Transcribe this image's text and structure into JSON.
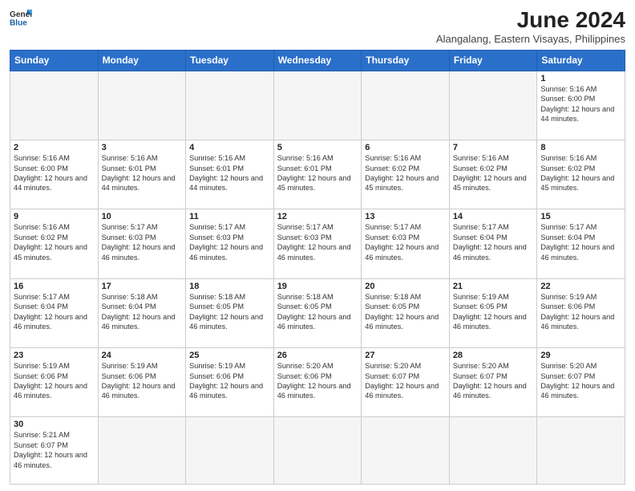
{
  "header": {
    "logo_general": "General",
    "logo_blue": "Blue",
    "month_year": "June 2024",
    "location": "Alangalang, Eastern Visayas, Philippines"
  },
  "days_of_week": [
    "Sunday",
    "Monday",
    "Tuesday",
    "Wednesday",
    "Thursday",
    "Friday",
    "Saturday"
  ],
  "weeks": [
    [
      {
        "day": null,
        "info": null
      },
      {
        "day": null,
        "info": null
      },
      {
        "day": null,
        "info": null
      },
      {
        "day": null,
        "info": null
      },
      {
        "day": null,
        "info": null
      },
      {
        "day": null,
        "info": null
      },
      {
        "day": "1",
        "info": "Sunrise: 5:16 AM\nSunset: 6:00 PM\nDaylight: 12 hours\nand 44 minutes."
      }
    ],
    [
      {
        "day": "2",
        "info": "Sunrise: 5:16 AM\nSunset: 6:00 PM\nDaylight: 12 hours\nand 44 minutes."
      },
      {
        "day": "3",
        "info": "Sunrise: 5:16 AM\nSunset: 6:01 PM\nDaylight: 12 hours\nand 44 minutes."
      },
      {
        "day": "4",
        "info": "Sunrise: 5:16 AM\nSunset: 6:01 PM\nDaylight: 12 hours\nand 44 minutes."
      },
      {
        "day": "5",
        "info": "Sunrise: 5:16 AM\nSunset: 6:01 PM\nDaylight: 12 hours\nand 45 minutes."
      },
      {
        "day": "6",
        "info": "Sunrise: 5:16 AM\nSunset: 6:02 PM\nDaylight: 12 hours\nand 45 minutes."
      },
      {
        "day": "7",
        "info": "Sunrise: 5:16 AM\nSunset: 6:02 PM\nDaylight: 12 hours\nand 45 minutes."
      },
      {
        "day": "8",
        "info": "Sunrise: 5:16 AM\nSunset: 6:02 PM\nDaylight: 12 hours\nand 45 minutes."
      }
    ],
    [
      {
        "day": "9",
        "info": "Sunrise: 5:16 AM\nSunset: 6:02 PM\nDaylight: 12 hours\nand 45 minutes."
      },
      {
        "day": "10",
        "info": "Sunrise: 5:17 AM\nSunset: 6:03 PM\nDaylight: 12 hours\nand 46 minutes."
      },
      {
        "day": "11",
        "info": "Sunrise: 5:17 AM\nSunset: 6:03 PM\nDaylight: 12 hours\nand 46 minutes."
      },
      {
        "day": "12",
        "info": "Sunrise: 5:17 AM\nSunset: 6:03 PM\nDaylight: 12 hours\nand 46 minutes."
      },
      {
        "day": "13",
        "info": "Sunrise: 5:17 AM\nSunset: 6:03 PM\nDaylight: 12 hours\nand 46 minutes."
      },
      {
        "day": "14",
        "info": "Sunrise: 5:17 AM\nSunset: 6:04 PM\nDaylight: 12 hours\nand 46 minutes."
      },
      {
        "day": "15",
        "info": "Sunrise: 5:17 AM\nSunset: 6:04 PM\nDaylight: 12 hours\nand 46 minutes."
      }
    ],
    [
      {
        "day": "16",
        "info": "Sunrise: 5:17 AM\nSunset: 6:04 PM\nDaylight: 12 hours\nand 46 minutes."
      },
      {
        "day": "17",
        "info": "Sunrise: 5:18 AM\nSunset: 6:04 PM\nDaylight: 12 hours\nand 46 minutes."
      },
      {
        "day": "18",
        "info": "Sunrise: 5:18 AM\nSunset: 6:05 PM\nDaylight: 12 hours\nand 46 minutes."
      },
      {
        "day": "19",
        "info": "Sunrise: 5:18 AM\nSunset: 6:05 PM\nDaylight: 12 hours\nand 46 minutes."
      },
      {
        "day": "20",
        "info": "Sunrise: 5:18 AM\nSunset: 6:05 PM\nDaylight: 12 hours\nand 46 minutes."
      },
      {
        "day": "21",
        "info": "Sunrise: 5:19 AM\nSunset: 6:05 PM\nDaylight: 12 hours\nand 46 minutes."
      },
      {
        "day": "22",
        "info": "Sunrise: 5:19 AM\nSunset: 6:06 PM\nDaylight: 12 hours\nand 46 minutes."
      }
    ],
    [
      {
        "day": "23",
        "info": "Sunrise: 5:19 AM\nSunset: 6:06 PM\nDaylight: 12 hours\nand 46 minutes."
      },
      {
        "day": "24",
        "info": "Sunrise: 5:19 AM\nSunset: 6:06 PM\nDaylight: 12 hours\nand 46 minutes."
      },
      {
        "day": "25",
        "info": "Sunrise: 5:19 AM\nSunset: 6:06 PM\nDaylight: 12 hours\nand 46 minutes."
      },
      {
        "day": "26",
        "info": "Sunrise: 5:20 AM\nSunset: 6:06 PM\nDaylight: 12 hours\nand 46 minutes."
      },
      {
        "day": "27",
        "info": "Sunrise: 5:20 AM\nSunset: 6:07 PM\nDaylight: 12 hours\nand 46 minutes."
      },
      {
        "day": "28",
        "info": "Sunrise: 5:20 AM\nSunset: 6:07 PM\nDaylight: 12 hours\nand 46 minutes."
      },
      {
        "day": "29",
        "info": "Sunrise: 5:20 AM\nSunset: 6:07 PM\nDaylight: 12 hours\nand 46 minutes."
      }
    ],
    [
      {
        "day": "30",
        "info": "Sunrise: 5:21 AM\nSunset: 6:07 PM\nDaylight: 12 hours\nand 46 minutes."
      },
      {
        "day": null,
        "info": null
      },
      {
        "day": null,
        "info": null
      },
      {
        "day": null,
        "info": null
      },
      {
        "day": null,
        "info": null
      },
      {
        "day": null,
        "info": null
      },
      {
        "day": null,
        "info": null
      }
    ]
  ]
}
